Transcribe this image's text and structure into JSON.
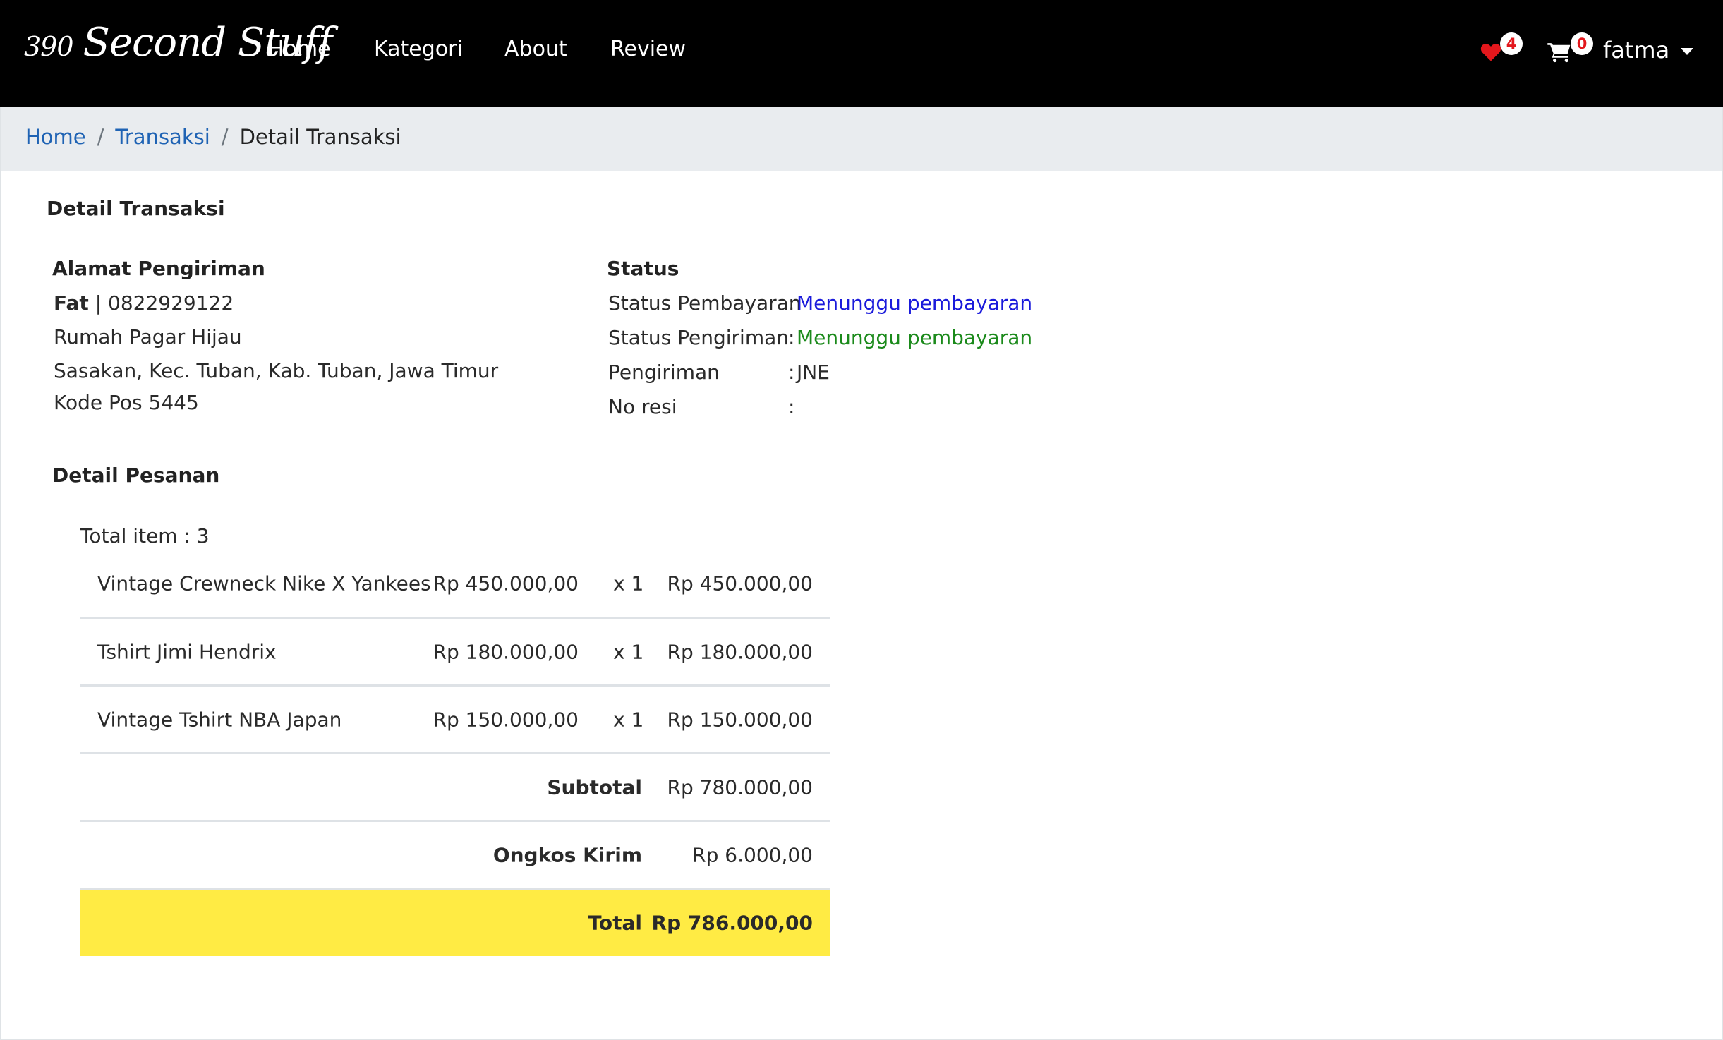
{
  "navbar": {
    "brand_number": "390",
    "brand_name": "Second Stuff",
    "links": [
      "Home",
      "Kategori",
      "About",
      "Review"
    ],
    "wishlist_count": "4",
    "cart_count": "0",
    "user": "fatma"
  },
  "breadcrumb": {
    "home": "Home",
    "transaksi": "Transaksi",
    "current": "Detail Transaksi"
  },
  "page": {
    "title": "Detail Transaksi"
  },
  "shipping": {
    "heading": "Alamat Pengiriman",
    "name": "Fat",
    "separator": " | ",
    "phone": "0822929122",
    "address_line1": "Rumah Pagar Hijau",
    "address_line2": "Sasakan, Kec. Tuban, Kab. Tuban, Jawa Timur",
    "postal": "Kode Pos 5445"
  },
  "status": {
    "heading": "Status",
    "rows": [
      {
        "label": "Status Pembayaran",
        "value": "Menunggu pembayaran",
        "color": "#1a1adb"
      },
      {
        "label": "Status Pengiriman",
        "value": "Menunggu pembayaran",
        "color": "#1b8a1b"
      },
      {
        "label": "Pengiriman",
        "value": "JNE",
        "color": "#2a2a2a"
      },
      {
        "label": "No resi",
        "value": "",
        "color": "#2a2a2a"
      }
    ]
  },
  "order": {
    "heading": "Detail Pesanan",
    "total_items": "Total item : 3",
    "items": [
      {
        "name": "Vintage Crewneck Nike X Yankees",
        "price": "Rp 450.000,00",
        "qty": "x 1",
        "subtotal": "Rp 450.000,00"
      },
      {
        "name": "Tshirt Jimi Hendrix",
        "price": "Rp 180.000,00",
        "qty": "x 1",
        "subtotal": "Rp 180.000,00"
      },
      {
        "name": "Vintage Tshirt NBA Japan",
        "price": "Rp 150.000,00",
        "qty": "x 1",
        "subtotal": "Rp 150.000,00"
      }
    ],
    "subtotal_label": "Subtotal",
    "subtotal_value": "Rp 780.000,00",
    "shipping_label": "Ongkos Kirim",
    "shipping_value": "Rp 6.000,00",
    "total_label": "Total",
    "total_value": "Rp 786.000,00",
    "total_bg": "#ffeb44"
  }
}
